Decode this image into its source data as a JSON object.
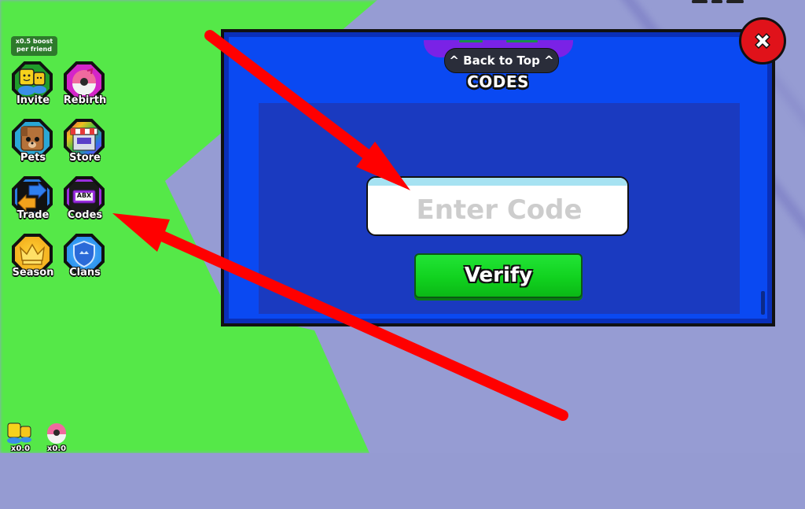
{
  "sidebar": {
    "boost_badge": "x0.5 boost\nper friend",
    "boost_line1": "x0.5 boost",
    "boost_line2": "per friend",
    "items": [
      {
        "label": "Invite",
        "icon": "friends-icon",
        "ring": "#1f9c2a"
      },
      {
        "label": "Rebirth",
        "icon": "rebirth-icon",
        "ring": "#d425c9"
      },
      {
        "label": "Pets",
        "icon": "dog-icon",
        "ring": "#2aa7d6"
      },
      {
        "label": "Store",
        "icon": "store-icon",
        "ring": "#e84a4a"
      },
      {
        "label": "Trade",
        "icon": "trade-icon",
        "ring": "#2a7de0"
      },
      {
        "label": "Codes",
        "icon": "codes-ticket-icon",
        "ring": "#9b2ee0"
      },
      {
        "label": "Season",
        "icon": "crown-icon",
        "ring": "#f0a514"
      },
      {
        "label": "Clans",
        "icon": "shield-icon",
        "ring": "#1f86e8"
      }
    ]
  },
  "counters": [
    {
      "icon": "friends-icon",
      "value": "x0.0"
    },
    {
      "icon": "rebirth-icon",
      "value": "x0.0"
    }
  ],
  "codes_panel": {
    "back_to_top": "^ Back to Top ^",
    "title": "CODES",
    "input_placeholder": "Enter Code",
    "input_value": "",
    "verify_label": "Verify",
    "codes_ticket_text": "ABX"
  },
  "colors": {
    "panel_blue": "#0a49f2",
    "inner_blue": "#1a3ac0",
    "verify_green": "#11d21f",
    "close_red": "#e0121a",
    "annotation_red": "#ff0000",
    "bg_green": "#55e848",
    "bg_lavender": "#969cd3"
  }
}
